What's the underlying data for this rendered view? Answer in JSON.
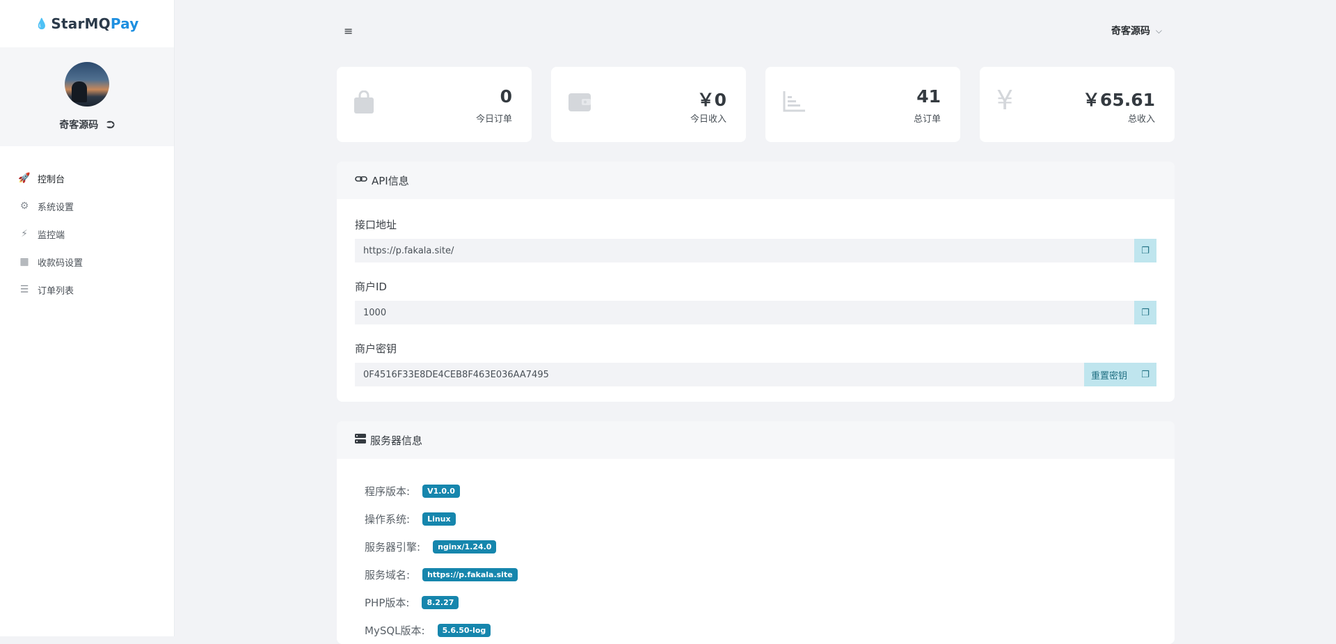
{
  "brand": {
    "part1": "StarMQ",
    "part2": "Pay"
  },
  "user": {
    "name": "奇客源码"
  },
  "nav": [
    {
      "label": "控制台",
      "icon": "rocket-icon",
      "active": true
    },
    {
      "label": "系统设置",
      "icon": "gear-icon"
    },
    {
      "label": "监控端",
      "icon": "bolt-icon"
    },
    {
      "label": "收款码设置",
      "icon": "qrcode-icon"
    },
    {
      "label": "订单列表",
      "icon": "list-icon"
    }
  ],
  "topbar": {
    "username": "奇客源码"
  },
  "stats": [
    {
      "value": "0",
      "label": "今日订单",
      "icon": "shopping-bag-icon"
    },
    {
      "value": "￥0",
      "label": "今日收入",
      "icon": "wallet-icon"
    },
    {
      "value": "41",
      "label": "总订单",
      "icon": "bar-chart-icon"
    },
    {
      "value": "￥65.61",
      "label": "总收入",
      "icon": "yen-icon"
    }
  ],
  "api": {
    "title": "API信息",
    "url_label": "接口地址",
    "url_value": "https://p.fakala.site/",
    "merchant_label": "商户ID",
    "merchant_value": "1000",
    "key_label": "商户密钥",
    "key_value": "0F4516F33E8DE4CEB8F463E036AA7495",
    "reset_label": "重置密钥"
  },
  "server": {
    "title": "服务器信息",
    "rows": [
      {
        "label": "程序版本:",
        "value": "V1.0.0"
      },
      {
        "label": "操作系统:",
        "value": "Linux"
      },
      {
        "label": "服务器引擎:",
        "value": "nginx/1.24.0"
      },
      {
        "label": "服务域名:",
        "value": "https://p.fakala.site"
      },
      {
        "label": "PHP版本:",
        "value": "8.2.27"
      },
      {
        "label": "MySQL版本:",
        "value": "5.6.50-log"
      }
    ]
  },
  "colors": {
    "accent": "#0d7fd8",
    "badge": "#1686ad",
    "copy_button": "#bfe5ee"
  }
}
